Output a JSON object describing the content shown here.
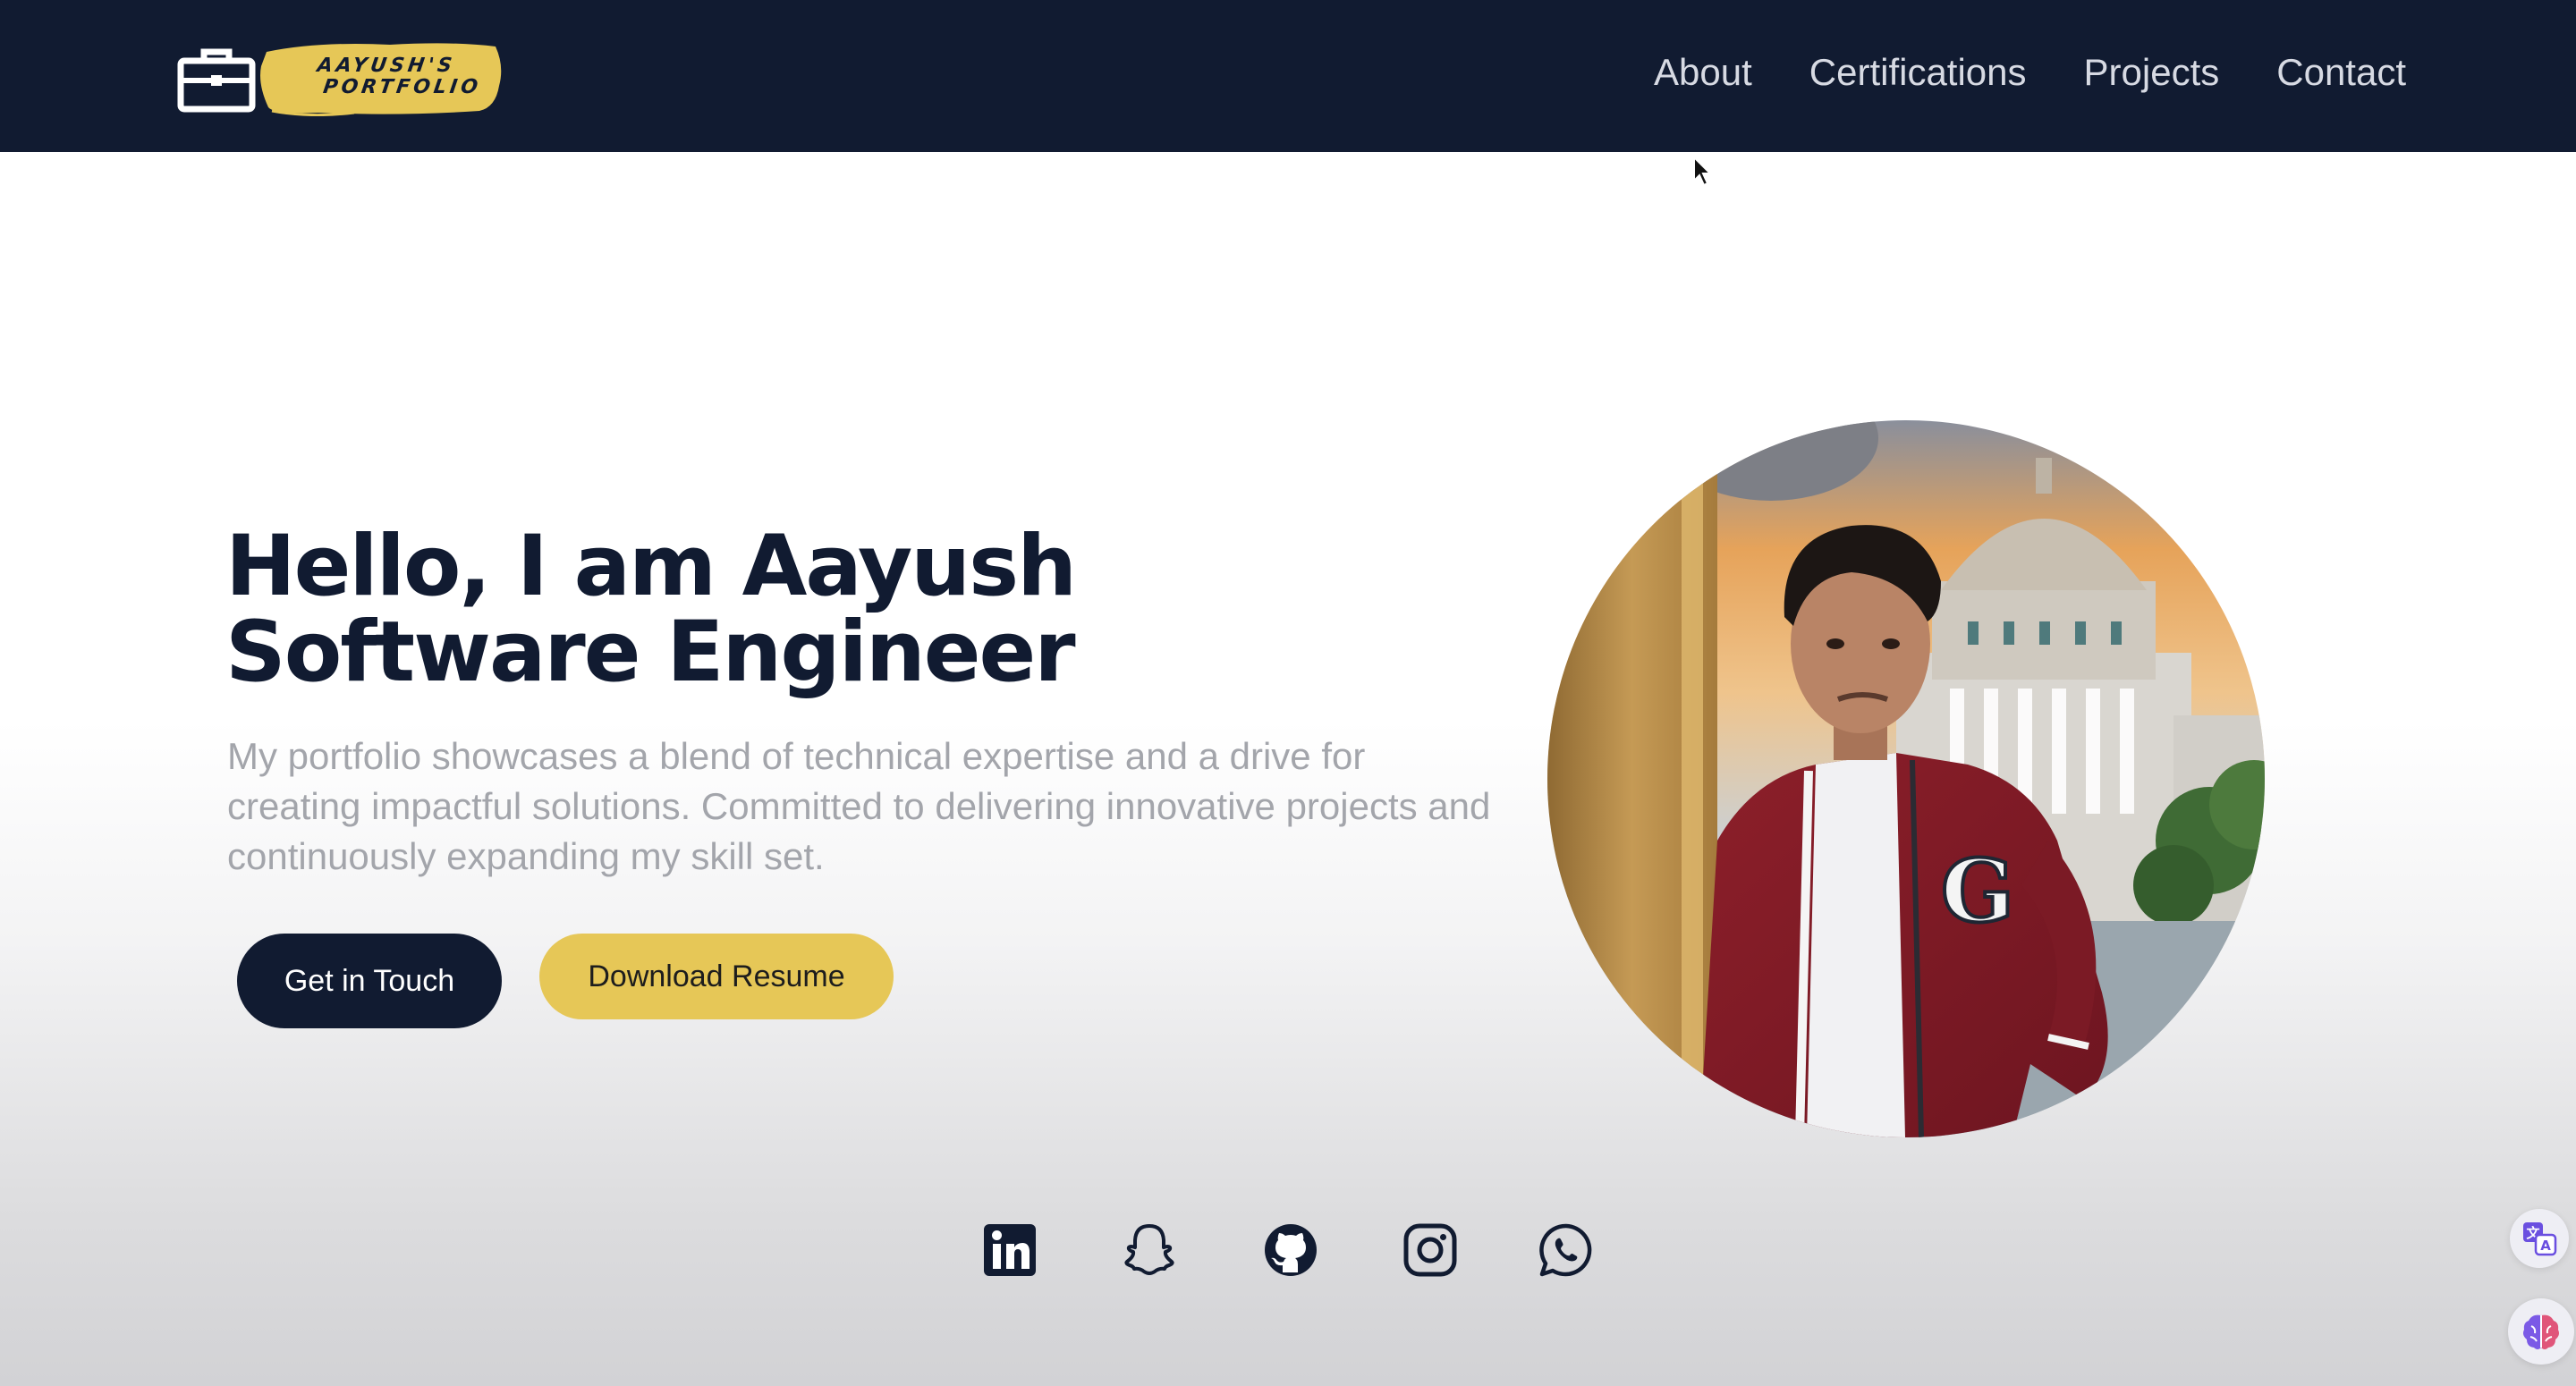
{
  "brand": {
    "logo_line1": "AAYUSH'S",
    "logo_line2": "PORTFOLIO",
    "icon": "briefcase-icon"
  },
  "nav": {
    "items": [
      {
        "label": "About"
      },
      {
        "label": "Certifications"
      },
      {
        "label": "Projects"
      },
      {
        "label": "Contact"
      }
    ]
  },
  "hero": {
    "title_line1": "Hello, I am Aayush",
    "title_line2": "Software Engineer",
    "description": "My portfolio showcases a blend of technical expertise and a drive for creating impactful solutions. Committed to delivering innovative projects and continuously expanding my skill set.",
    "primary_button": "Get in Touch",
    "secondary_button": "Download Resume"
  },
  "social": {
    "icons": [
      "linkedin-icon",
      "snapchat-icon",
      "github-icon",
      "instagram-icon",
      "whatsapp-icon"
    ]
  },
  "colors": {
    "navy": "#111b31",
    "accent_yellow": "#e6c757",
    "muted_text": "#a3a5ab",
    "nav_text": "#d7dae3"
  }
}
